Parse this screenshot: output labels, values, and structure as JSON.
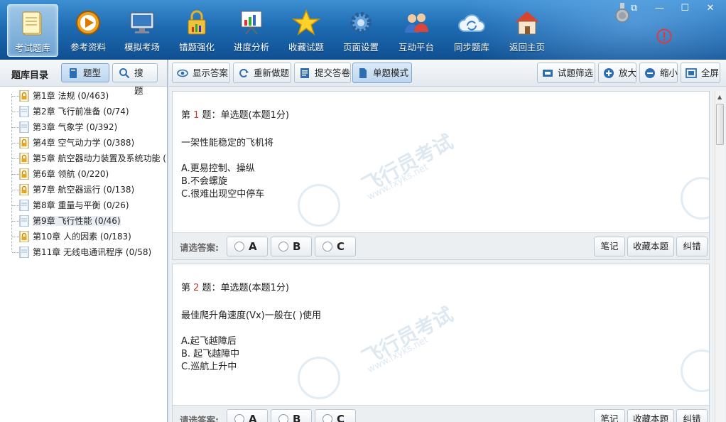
{
  "nav": [
    {
      "label": "考试题库",
      "icon": "notebook-icon",
      "active": true
    },
    {
      "label": "参考资料",
      "icon": "play-disc-icon"
    },
    {
      "label": "模拟考场",
      "icon": "monitor-icon"
    },
    {
      "label": "错题强化",
      "icon": "lock-chart-icon"
    },
    {
      "label": "进度分析",
      "icon": "presentation-chart-icon"
    },
    {
      "label": "收藏试题",
      "icon": "star-icon"
    },
    {
      "label": "页面设置",
      "icon": "gear-icon"
    },
    {
      "label": "互动平台",
      "icon": "users-icon"
    },
    {
      "label": "同步题库",
      "icon": "cloud-sync-icon"
    },
    {
      "label": "返回主页",
      "icon": "home-icon"
    }
  ],
  "window_buttons": {
    "restore": "⧉",
    "minimize": "—",
    "maximize": "☐",
    "close": "✕"
  },
  "left": {
    "title": "题库目录",
    "type_button": "题型",
    "search_button": "搜题",
    "chapters": [
      {
        "label": "第1章  法规 (0/463)",
        "locked": true
      },
      {
        "label": "第2章  飞行前准备 (0/74)",
        "locked": false
      },
      {
        "label": "第3章  气象学 (0/392)",
        "locked": false
      },
      {
        "label": "第4章  空气动力学 (0/388)",
        "locked": true
      },
      {
        "label": "第5章  航空器动力装置及系统功能 (",
        "locked": true
      },
      {
        "label": "第6章  领航 (0/220)",
        "locked": true
      },
      {
        "label": "第7章  航空器运行 (0/138)",
        "locked": true
      },
      {
        "label": "第8章  重量与平衡 (0/26)",
        "locked": false
      },
      {
        "label": "第9章  飞行性能 (0/46)",
        "locked": false,
        "selected": true
      },
      {
        "label": "第10章  人的因素 (0/183)",
        "locked": true
      },
      {
        "label": "第11章  无线电通讯程序 (0/58)",
        "locked": false
      }
    ]
  },
  "toolbar": {
    "show_answer": "显示答案",
    "redo": "重新做题",
    "submit": "提交答卷",
    "single_mode": "单题模式",
    "filter": "试题筛选",
    "zoom_in": "放大",
    "zoom_out": "缩小",
    "fullscreen": "全屏"
  },
  "questions": [
    {
      "prefix": "第 ",
      "num": "1",
      "suffix": " 题：单选题(本题1分)",
      "stem": "一架性能稳定的飞机将",
      "options": [
        "A.更易控制、操纵",
        "B.不会螺旋",
        "C.很难出现空中停车"
      ]
    },
    {
      "prefix": "第 ",
      "num": "2",
      "suffix": " 题：单选题(本题1分)",
      "stem": "最佳爬升角速度(Vx)一般在( )使用",
      "options": [
        "A.起飞越障后",
        "B. 起飞越障中",
        "C.巡航上升中"
      ]
    }
  ],
  "answer_bar": {
    "label": "请选答案:",
    "choices": [
      "A",
      "B",
      "C"
    ],
    "note": "笔记",
    "favorite": "收藏本题",
    "correct": "纠错"
  },
  "watermark": {
    "text": "飞行员考试",
    "url": "www.fxyks.net"
  },
  "colors": {
    "ribbon_top": "#3e8fd2",
    "ribbon_bottom": "#0f4f91",
    "question_number": "#c0392b",
    "alert": "#e0393e"
  }
}
